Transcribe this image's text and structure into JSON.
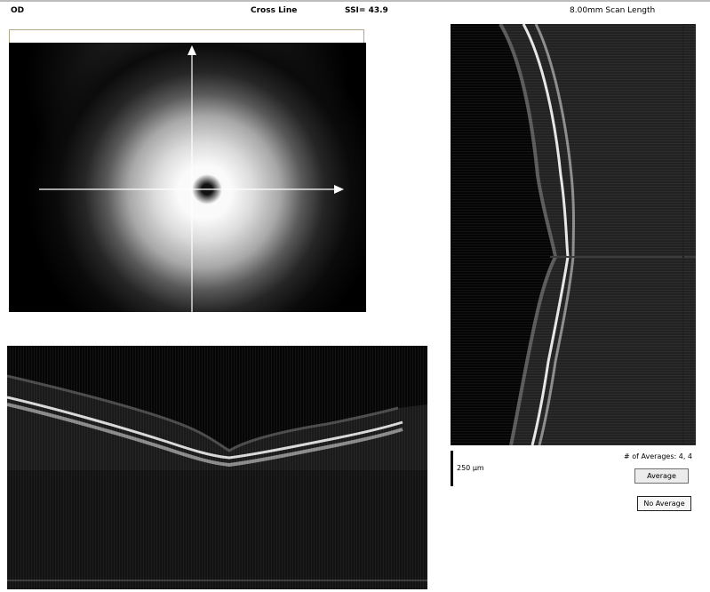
{
  "header": {
    "eye": "OD",
    "scan_type": "Cross Line",
    "ssi": "SSI= 43.9",
    "scan_length": "8.00mm Scan Length"
  },
  "scale": {
    "label": "250 µm"
  },
  "averages": {
    "label": "# of Averages: 4, 4"
  },
  "buttons": {
    "average": "Average",
    "no_average": "No Average"
  }
}
